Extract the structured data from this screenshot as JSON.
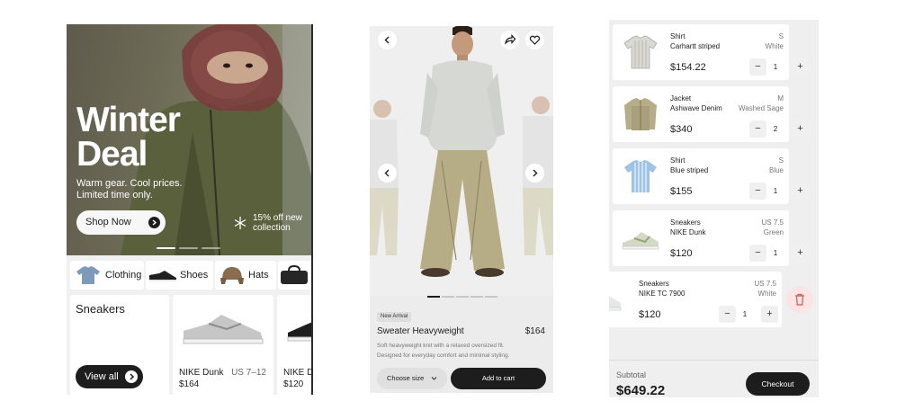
{
  "home": {
    "hero": {
      "title_line1": "Winter",
      "title_line2": "Deal",
      "subtitle_line1": "Warm gear. Cool prices.",
      "subtitle_line2": "Limited time only.",
      "cta_label": "Shop Now",
      "promo_line1": "15% off new",
      "promo_line2": "collection",
      "carousel_active_index": 0,
      "carousel_count": 3
    },
    "categories": [
      {
        "label": "Clothing",
        "icon": "shirt-icon"
      },
      {
        "label": "Shoes",
        "icon": "sneaker-icon"
      },
      {
        "label": "Hats",
        "icon": "hat-icon"
      },
      {
        "label": "",
        "icon": "bag-icon"
      }
    ],
    "section_title": "Sneakers",
    "view_all_label": "View all",
    "products": [
      {
        "name": "NIKE Dunk",
        "size": "US 7–12",
        "price": "$164"
      },
      {
        "name": "NIKE Du",
        "price": "$120"
      }
    ]
  },
  "product": {
    "badge": "New Arrival",
    "name": "Sweater Heavyweight",
    "price": "$164",
    "description_line1": "Soft heavyweight knit with a relaxed oversized fit.",
    "description_line2": "Designed for everyday comfort and minimal styling.",
    "size_label": "Choose size",
    "cart_label": "Add to cart",
    "gallery_active_index": 0,
    "gallery_count": 5
  },
  "cart": {
    "items": [
      {
        "category": "Shirt",
        "name": "Carhartt striped",
        "price": "$154.22",
        "size": "S",
        "color": "White",
        "qty": "1"
      },
      {
        "category": "Jacket",
        "name": "Ashwave Denim",
        "price": "$340",
        "size": "M",
        "color": "Washed Sage",
        "qty": "2"
      },
      {
        "category": "Shirt",
        "name": "Blue striped",
        "price": "$155",
        "size": "S",
        "color": "Blue",
        "qty": "1"
      },
      {
        "category": "Sneakers",
        "name": "NIKE Dunk",
        "price": "$120",
        "size": "US 7.5",
        "color": "Green",
        "qty": "1"
      },
      {
        "category": "Sneakers",
        "name": "NIKE TC 7900",
        "price": "$120",
        "size": "US 7.5",
        "color": "White",
        "qty": "1"
      }
    ],
    "minus_glyph": "−",
    "plus_glyph": "+",
    "subtotal_label": "Subtotal",
    "subtotal_value": "$649.22",
    "checkout_label": "Checkout"
  },
  "colors": {
    "ink": "#1c1c1c",
    "accent_dark": "#1d1d1d",
    "delete_bg": "#fbe4e4",
    "delete_icon": "#d9534f"
  }
}
